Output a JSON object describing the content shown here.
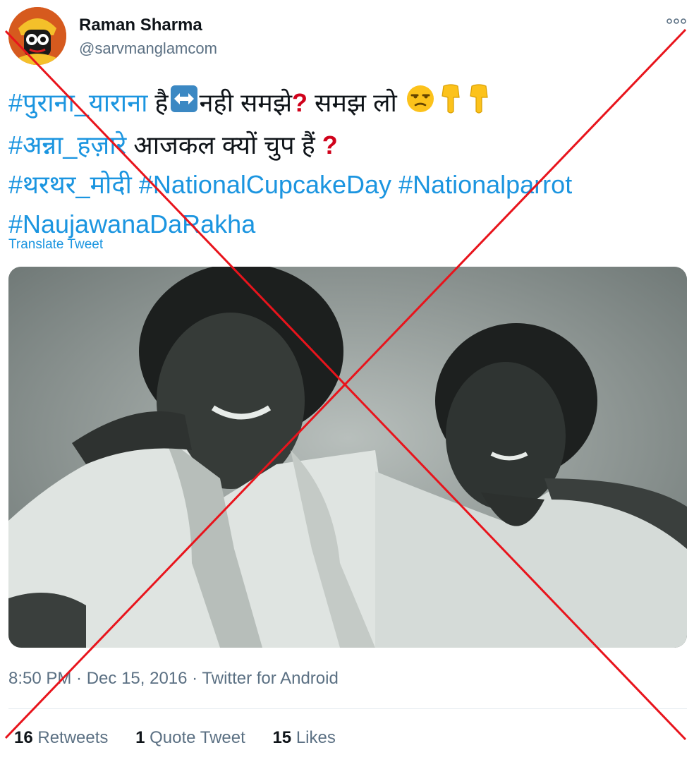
{
  "user": {
    "name": "Raman Sharma",
    "handle": "@sarvmanglamcom"
  },
  "tweet": {
    "line1": {
      "tag": "#पुराना_याराना",
      "text_a": " है",
      "text_b": "नही समझे",
      "text_c": " समझ लो "
    },
    "line2": {
      "tag": "#अन्ना_हज़ारे",
      "text": " आजकल क्यों चुप हैं "
    },
    "line3": {
      "tag1": "#थरथर_मोदी",
      "tag2": "#NationalCupcakeDay",
      "tag3": "#Nationalparrot"
    },
    "line4": {
      "tag": "#NaujawanaDaRakha"
    },
    "question_mark": "?",
    "translate_label": "Translate Tweet"
  },
  "meta": {
    "time": "8:50 PM",
    "date": "Dec 15, 2016",
    "source": "Twitter for Android",
    "sep": " · "
  },
  "stats": {
    "retweets_count": "16",
    "retweets_label": "Retweets",
    "quote_count": "1",
    "quote_label": "Quote Tweet",
    "likes_count": "15",
    "likes_label": "Likes"
  },
  "icons": {
    "more": "more-icon",
    "arrow": "left-right-arrow-icon",
    "unamused": "unamused-face-icon",
    "point_down": "backhand-index-pointing-down-icon",
    "question": "red-question-mark-icon"
  },
  "colors": {
    "link": "#1b95e0",
    "cross": "#e8141c",
    "secondary": "#5b7083"
  }
}
